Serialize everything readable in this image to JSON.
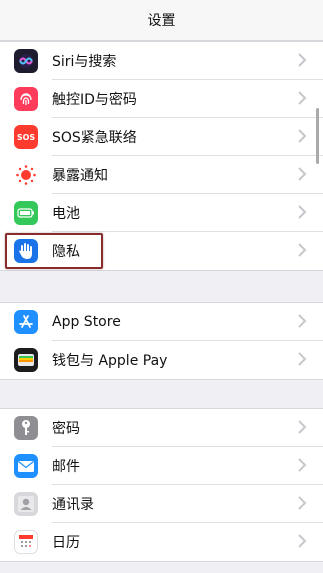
{
  "navbar": {
    "title": "设置"
  },
  "group1": [
    {
      "label": "Siri与搜索",
      "icon": "siri-icon"
    },
    {
      "label": "触控ID与密码",
      "icon": "fingerprint-icon"
    },
    {
      "label": "SOS紧急联络",
      "icon": "sos-icon",
      "icon_text": "SOS"
    },
    {
      "label": "暴露通知",
      "icon": "exposure-notification-icon"
    },
    {
      "label": "电池",
      "icon": "battery-icon"
    },
    {
      "label": "隐私",
      "icon": "hand-privacy-icon"
    }
  ],
  "group2": [
    {
      "label": "App Store",
      "icon": "app-store-icon"
    },
    {
      "label": "钱包与 Apple Pay",
      "icon": "wallet-icon"
    }
  ],
  "group3": [
    {
      "label": "密码",
      "icon": "key-icon"
    },
    {
      "label": "邮件",
      "icon": "mail-icon"
    },
    {
      "label": "通讯录",
      "icon": "contacts-icon"
    },
    {
      "label": "日历",
      "icon": "calendar-icon"
    }
  ],
  "colors": {
    "background": "#efeff4",
    "highlight_border": "#8b2b2b",
    "chevron": "#c7c7cc"
  }
}
